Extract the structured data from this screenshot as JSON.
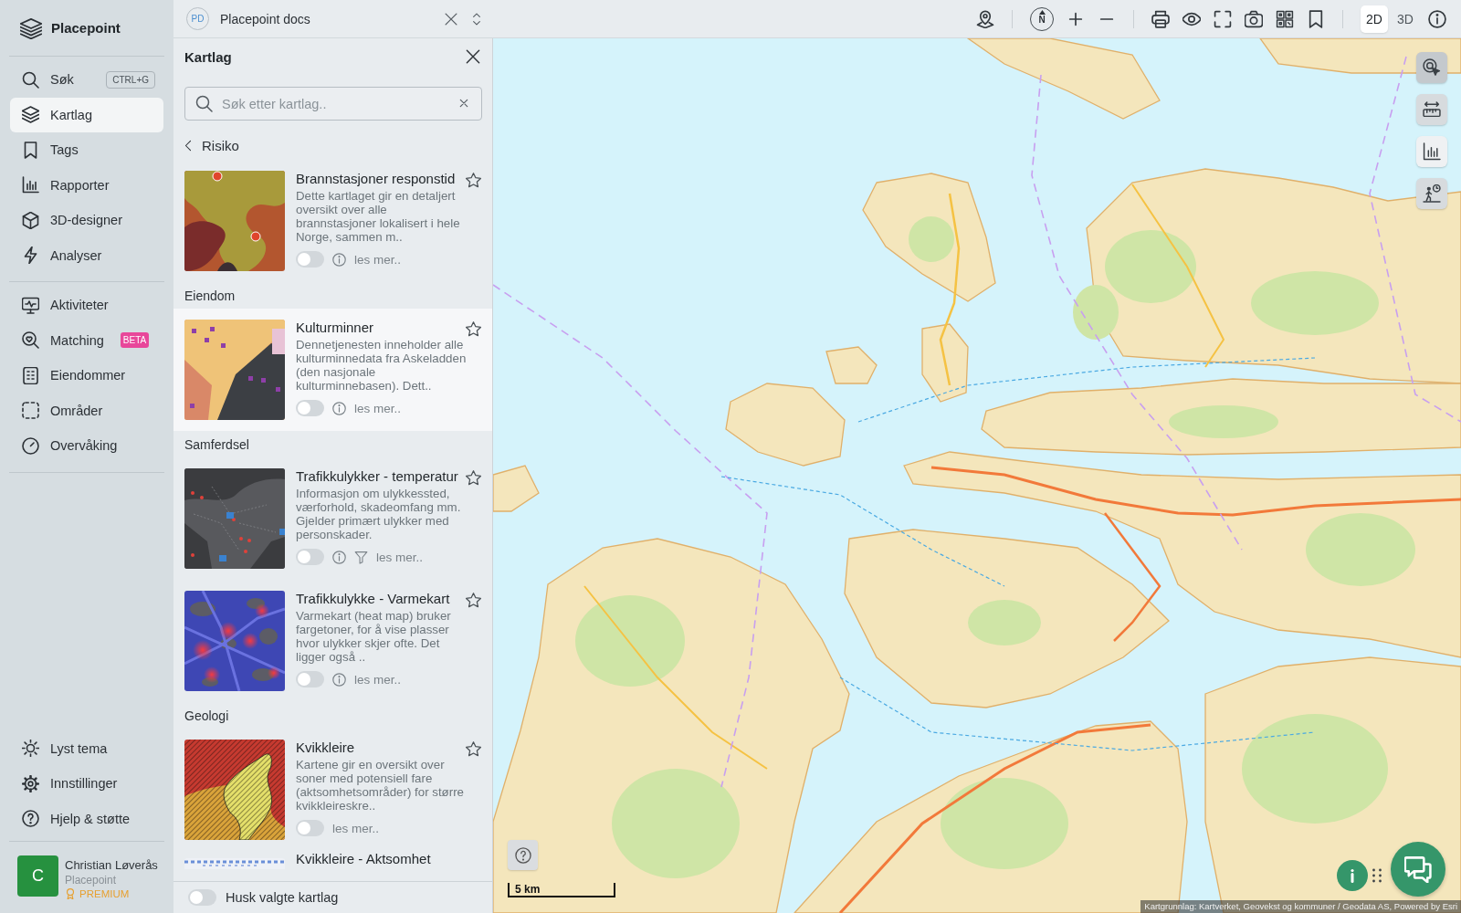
{
  "sidebar": {
    "brand": "Placepoint",
    "groups": [
      {
        "items": [
          {
            "label": "Søk",
            "shortcut": "CTRL+G",
            "selected": false
          },
          {
            "label": "Kartlag",
            "selected": true
          },
          {
            "label": "Tags",
            "selected": false
          },
          {
            "label": "Rapporter",
            "selected": false
          },
          {
            "label": "3D-designer",
            "selected": false
          },
          {
            "label": "Analyser",
            "selected": false
          }
        ]
      },
      {
        "items": [
          {
            "label": "Aktiviteter",
            "selected": false
          },
          {
            "label": "Matching",
            "badge": "BETA",
            "selected": false
          },
          {
            "label": "Eiendommer",
            "selected": false
          },
          {
            "label": "Områder",
            "selected": false
          },
          {
            "label": "Overvåking",
            "selected": false
          }
        ]
      }
    ],
    "bottom_items": [
      {
        "label": "Lyst tema"
      },
      {
        "label": "Innstillinger"
      },
      {
        "label": "Hjelp & støtte"
      }
    ],
    "user": {
      "initial": "C",
      "name": "Christian Løverås",
      "organization": "Placepoint",
      "plan": "PREMIUM"
    }
  },
  "workspace": {
    "badge": "PD",
    "title": "Placepoint docs"
  },
  "layer_panel": {
    "title": "Kartlag",
    "search": {
      "placeholder": "Søk etter kartlag.."
    },
    "back_link": "Risiko",
    "groups": [
      {
        "layers": [
          {
            "kind": "full",
            "title": "Brannstasjoner responstid",
            "description": "Dette kartlaget gir en detaljert oversikt over alle brannstasjoner lokalisert i hele Norge, sammen m..",
            "on": false,
            "favorite": false,
            "highlighted": false,
            "info": true,
            "filter": false,
            "more": "les mer.."
          }
        ]
      },
      {
        "heading": "Eiendom",
        "layers": [
          {
            "kind": "full",
            "title": "Kulturminner",
            "description": "Dennetjenesten inneholder alle kulturminnedata fra Askeladden (den nasjonale kulturminnebasen). Dett..",
            "on": false,
            "favorite": false,
            "highlighted": true,
            "info": true,
            "filter": false,
            "more": "les mer.."
          }
        ]
      },
      {
        "heading": "Samferdsel",
        "layers": [
          {
            "kind": "full",
            "title": "Trafikkulykker - temperatur",
            "description": "Informasjon om ulykkessted, værforhold, skadeomfang mm. Gjelder primært ulykker med personskader.",
            "on": false,
            "favorite": false,
            "highlighted": false,
            "info": true,
            "filter": true,
            "more": "les mer.."
          },
          {
            "kind": "full",
            "title": "Trafikkulykke - Varmekart",
            "description": "Varmekart (heat map) bruker fargetoner, for å vise plasser hvor ulykker skjer ofte. Det ligger også ..",
            "on": false,
            "favorite": false,
            "highlighted": false,
            "info": true,
            "filter": false,
            "more": "les mer.."
          }
        ]
      },
      {
        "heading": "Geologi",
        "layers": [
          {
            "kind": "full",
            "title": "Kvikkleire",
            "description": "Kartene gir en oversikt over soner med potensiell fare (aktsomhetsområder) for større kvikkleireskre..",
            "on": false,
            "favorite": false,
            "highlighted": false,
            "info": false,
            "filter": false,
            "more": "les mer.."
          },
          {
            "kind": "cut",
            "title": "Kvikkleire - Aktsomhet"
          }
        ]
      }
    ],
    "remember": {
      "label": "Husk valgte kartlag",
      "on": false
    }
  },
  "toolbar": {
    "compass": "N",
    "view_modes": [
      {
        "label": "2D",
        "selected": true
      },
      {
        "label": "3D",
        "selected": false
      }
    ]
  },
  "map": {
    "tools": [
      {
        "selected": true,
        "hovered": false
      },
      {
        "selected": false,
        "hovered": false
      },
      {
        "selected": false,
        "hovered": true
      },
      {
        "selected": false,
        "hovered": false
      }
    ],
    "scale": "5 km",
    "attribution": "Kartgrunnlag: Kartverket, Geovekst og kommuner / Geodata AS, Powered by Esri"
  }
}
